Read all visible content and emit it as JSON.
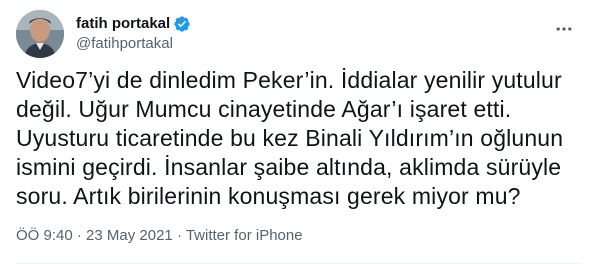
{
  "author": {
    "display_name": "fatih portakal",
    "handle": "@fatihportakal",
    "verified": true
  },
  "tweet": {
    "text": "Video7’yi de dinledim Peker’in. İddialar yenilir yutulur değil. Uğur Mumcu cinayetinde Ağar’ı işaret etti. Uyusturu ticaretinde bu kez Binali Yıldırım’ın oğlunun ismini geçirdi. İnsanlar şaibe altında, aklimda sürüyle soru. Artık birilerinin konuşması gerek miyor mu?",
    "time": "ÖÖ 9:40",
    "date": "23 May 2021",
    "source": "Twitter for iPhone",
    "separator": " · "
  },
  "colors": {
    "verified": "#1d9bf0",
    "muted": "#536471",
    "text": "#0f1419"
  },
  "icons": {
    "verified": "verified-badge-icon",
    "more": "more-horizontal-icon"
  }
}
